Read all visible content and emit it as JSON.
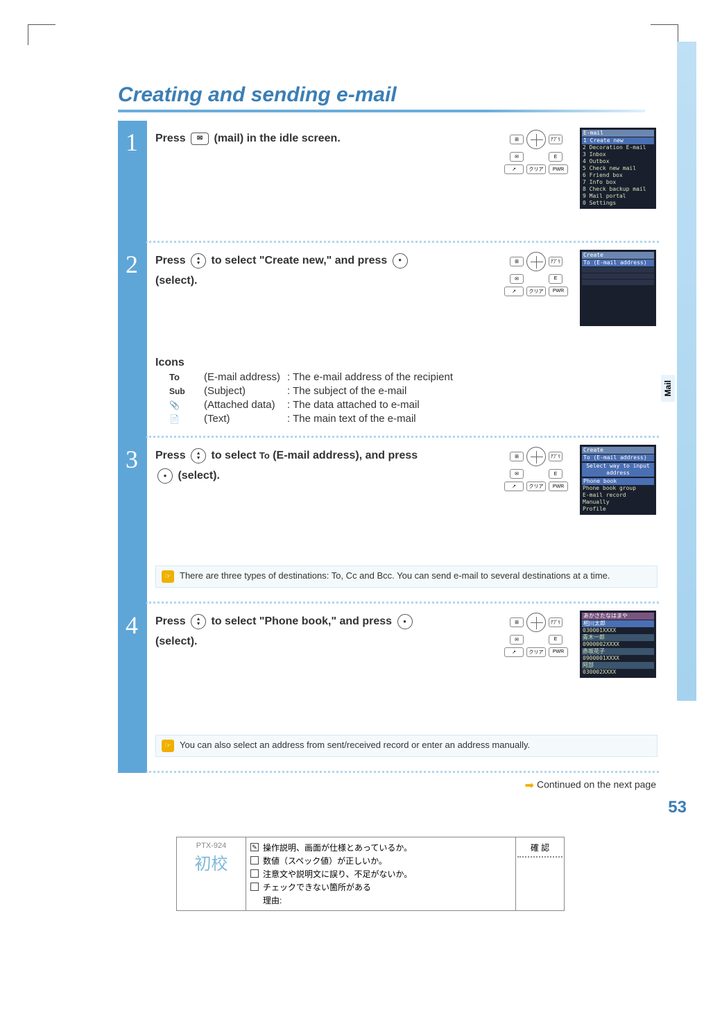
{
  "title": "Creating and sending e-mail",
  "side_tab": "Mail",
  "page_number": "53",
  "steps": {
    "s1": {
      "num": "1",
      "text_a": "Press ",
      "text_b": " (mail) in the idle screen."
    },
    "s2": {
      "num": "2",
      "text_a": "Press ",
      "text_b": " to select \"Create new,\" and press ",
      "text_c": " (select)."
    },
    "s3": {
      "num": "3",
      "text_a": "Press ",
      "text_b": " to select ",
      "text_c": " (E-mail address), and press ",
      "text_d": " (select)."
    },
    "s4": {
      "num": "4",
      "text_a": "Press ",
      "text_b": " to select \"Phone book,\" and press ",
      "text_c": " (select)."
    }
  },
  "icons_section": {
    "heading": "Icons",
    "rows": [
      {
        "lbl": "To",
        "key": "(E-mail address)",
        "desc": ": The e-mail address of the recipient"
      },
      {
        "lbl": "Sub",
        "key": "(Subject)",
        "desc": ": The subject of the e-mail"
      },
      {
        "lbl": "clip",
        "key": "(Attached data)",
        "desc": ": The data attached to e-mail"
      },
      {
        "lbl": "doc",
        "key": "(Text)",
        "desc": ": The main text of the e-mail"
      }
    ]
  },
  "tips": {
    "t3": "There are three types of destinations: To, Cc and Bcc. You can send e-mail to several destinations at a time.",
    "t4": "You can also select an address from sent/received record or enter an address manually."
  },
  "continued": "Continued on the next page",
  "keypad_label_clear": "クリア",
  "keypad_label_pwr": "PWR",
  "keypad_label_e": "E",
  "keypad_label_apuri": "ｱﾌﾟﾘ",
  "screens": {
    "sc1": {
      "hdr": "E-mail",
      "items": [
        "1 Create new",
        "2 Decoration E-mail",
        "3 Inbox",
        "4 Outbox",
        "5 Check new mail",
        "6 Friend box",
        "7 Info box",
        "8 Check backup mail",
        "9 Mail portal",
        "0 Settings"
      ]
    },
    "sc2": {
      "hdr": "Create",
      "sel": "To (E-mail address)"
    },
    "sc3": {
      "hdr": "Create",
      "sel": "To (E-mail address)",
      "prompt": "Select way to input address",
      "items": [
        "Phone book",
        "Phone book group",
        "E-mail record",
        "Manually",
        "Profile"
      ]
    },
    "sc4": {
      "hdr": "あかさたなはまや",
      "items": [
        "相川太郎",
        "  030001XXXX",
        "青木一郎",
        "  0900002XXXX",
        "赤坂花子",
        "  0900001XXXX",
        "阿部",
        "  030002XXXX"
      ]
    }
  },
  "proof": {
    "pid": "PTX-924",
    "shokou": "初校",
    "rows": [
      "操作説明、画面が仕様とあっているか。",
      "数値（スペック値）が正しいか。",
      "注意文や説明文に誤り、不足がないか。",
      "チェックできない箇所がある",
      "理由:"
    ],
    "kakunin": "確 認"
  }
}
